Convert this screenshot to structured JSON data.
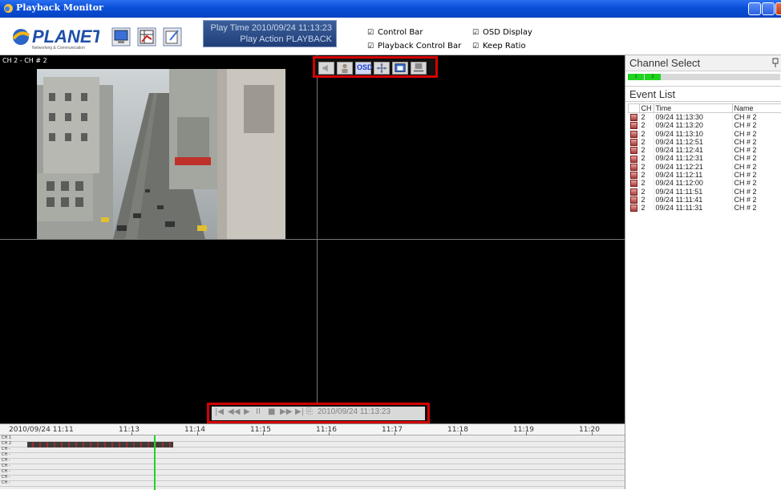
{
  "window": {
    "title": "Playback Monitor"
  },
  "toolbar": {
    "logo_text": "PLANET",
    "logo_tagline": "Networking & Communication",
    "play_time_label": "Play Time",
    "play_time_value": "2010/09/24 11:13:23",
    "play_action_label": "Play Action",
    "play_action_value": "PLAYBACK",
    "options": {
      "control_bar": "Control Bar",
      "playback_control_bar": "Playback Control Bar",
      "osd_display": "OSD Display",
      "keep_ratio": "Keep Ratio"
    },
    "checked": {
      "control_bar": true,
      "playback_control_bar": true,
      "osd_display": true,
      "keep_ratio": true
    }
  },
  "video": {
    "channel_label": "CH 2 - CH # 2",
    "osd_controls": [
      "speaker-icon",
      "person-icon",
      "osd-button",
      "ptz-icon",
      "snapshot-icon",
      "record-icon"
    ],
    "osd_label": "OSD",
    "playback": {
      "controls": [
        "skip-start",
        "rewind",
        "play",
        "pause",
        "stop",
        "fast-forward",
        "skip-end"
      ],
      "glyphs": [
        "|◀",
        "◀◀",
        "▶",
        "II",
        "■",
        "▶▶",
        "▶|",
        "⎘"
      ],
      "time": "2010/09/24 11:13:23"
    }
  },
  "timeline": {
    "start_label": "2010/09/24 11:11",
    "ticks": [
      "11:13",
      "11:14",
      "11:15",
      "11:16",
      "11:17",
      "11:18",
      "11:19",
      "11:20"
    ],
    "channels": [
      "CH 1",
      "CH 2",
      "CH -",
      "CH -",
      "CH -",
      "CH -",
      "CH -",
      "CH -",
      "CH -"
    ]
  },
  "right_panel": {
    "channel_select_title": "Channel Select",
    "channels": [
      "1",
      "2"
    ],
    "event_list_title": "Event List",
    "columns": [
      "CH",
      "Time",
      "Name"
    ],
    "events": [
      {
        "ch": "2",
        "time": "09/24 11:13:30",
        "name": "CH # 2"
      },
      {
        "ch": "2",
        "time": "09/24 11:13:20",
        "name": "CH # 2"
      },
      {
        "ch": "2",
        "time": "09/24 11:13:10",
        "name": "CH # 2"
      },
      {
        "ch": "2",
        "time": "09/24 11:12:51",
        "name": "CH # 2"
      },
      {
        "ch": "2",
        "time": "09/24 11:12:41",
        "name": "CH # 2"
      },
      {
        "ch": "2",
        "time": "09/24 11:12:31",
        "name": "CH # 2"
      },
      {
        "ch": "2",
        "time": "09/24 11:12:21",
        "name": "CH # 2"
      },
      {
        "ch": "2",
        "time": "09/24 11:12:11",
        "name": "CH # 2"
      },
      {
        "ch": "2",
        "time": "09/24 11:12:00",
        "name": "CH # 2"
      },
      {
        "ch": "2",
        "time": "09/24 11:11:51",
        "name": "CH # 2"
      },
      {
        "ch": "2",
        "time": "09/24 11:11:41",
        "name": "CH # 2"
      },
      {
        "ch": "2",
        "time": "09/24 11:11:31",
        "name": "CH # 2"
      }
    ]
  },
  "colors": {
    "titlebar": "#0a4fd8",
    "highlight_box": "#d40000",
    "timeline_cursor": "#1fd41f",
    "recording_segment": "#a02a2a"
  }
}
